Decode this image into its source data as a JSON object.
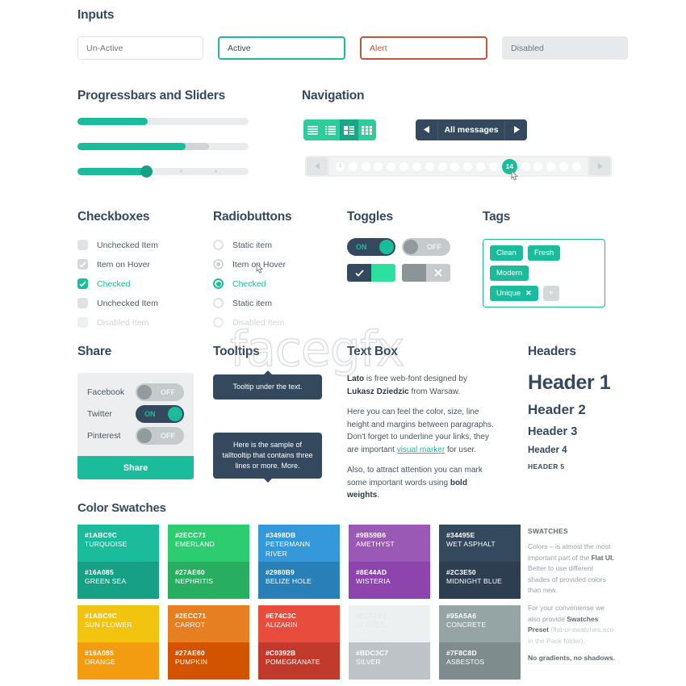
{
  "watermark": "facegfx",
  "sections": {
    "inputs": "Inputs",
    "progress": "Progressbars and Sliders",
    "navigation": "Navigation",
    "checkboxes": "Checkboxes",
    "radiobuttons": "Radiobuttons",
    "toggles": "Toggles",
    "tags": "Tags",
    "share": "Share",
    "tooltips": "Tooltips",
    "textbox": "Text Box",
    "headers": "Headers",
    "swatches": "Color Swatches"
  },
  "inputs": [
    {
      "name": "un-active",
      "value": "",
      "placeholder": "Un-Active",
      "state": "default"
    },
    {
      "name": "active",
      "value": "Active",
      "placeholder": "Active",
      "state": "active"
    },
    {
      "name": "alert",
      "value": "Alert",
      "placeholder": "Alert",
      "state": "alert"
    },
    {
      "name": "disabled",
      "value": "",
      "placeholder": "Disabled",
      "state": "disabled"
    }
  ],
  "progress": {
    "bars": [
      {
        "percent": 41,
        "secondary": 0
      },
      {
        "percent": 63,
        "secondary": 77
      }
    ],
    "slider": {
      "percent": 40,
      "ticks_percent": [
        60,
        80
      ]
    }
  },
  "navigation": {
    "view_modes": [
      {
        "icon": "list-lines-icon",
        "active": false
      },
      {
        "icon": "list-bullets-icon",
        "active": false
      },
      {
        "icon": "list-detail-icon",
        "active": true
      },
      {
        "icon": "grid-icon",
        "active": false
      }
    ],
    "messages": {
      "prev_icon": "triangle-left-icon",
      "label": "All messages",
      "next_icon": "triangle-right-icon"
    },
    "pager": {
      "prev_icon": "triangle-left-icon",
      "next_icon": "triangle-right-icon",
      "first_label": "1",
      "current_label": "14",
      "dots_before_current": 12,
      "dots_after_current": 5
    }
  },
  "checkboxes": [
    {
      "label": "Unchecked Item",
      "state": "unchecked"
    },
    {
      "label": "Item on Hover",
      "state": "hover"
    },
    {
      "label": "Checked",
      "state": "checked"
    },
    {
      "label": "Unchecked Item",
      "state": "unchecked"
    },
    {
      "label": "Disabled Item",
      "state": "disabled"
    }
  ],
  "radiobuttons": [
    {
      "label": "Static item",
      "state": "unchecked"
    },
    {
      "label": "Item on Hover",
      "state": "hover"
    },
    {
      "label": "Checked",
      "state": "checked"
    },
    {
      "label": "Static item",
      "state": "unchecked"
    },
    {
      "label": "Disabled Item",
      "state": "disabled"
    }
  ],
  "toggles": {
    "pill_on": "ON",
    "pill_off": "OFF",
    "square_on_icon": "check-icon",
    "square_off_icon": "cross-icon"
  },
  "tags": {
    "items": [
      "Clean",
      "Fresh",
      "Modern"
    ],
    "removable": {
      "label": "Unique",
      "remove_icon": "cross-icon"
    },
    "add_label": "+"
  },
  "share": {
    "rows": [
      {
        "label": "Facebook",
        "state": "OFF"
      },
      {
        "label": "Twitter",
        "state": "ON"
      },
      {
        "label": "Pinterest",
        "state": "OFF"
      }
    ],
    "button": "Share"
  },
  "tooltips": [
    "Tooltip under the text.",
    "Here is the sample of talltooltip that contains three lines or more. More."
  ],
  "textbox": {
    "p1_bold1": "Lato",
    "p1_mid": " is free web-font designed by ",
    "p1_bold2": "Lukasz Dziedzic",
    "p1_end": " from Warsaw.",
    "p2_start": "Here you can feel the color, size, line height and margins between paragraphs. Don't forget to underline your links, they are important ",
    "p2_link": "visual marker",
    "p2_end": " for user.",
    "p3_start": "Also, to attract attention you can mark some important words using ",
    "p3_bold": "bold weights",
    "p3_end": "."
  },
  "headers": {
    "h1": "Header 1",
    "h2": "Header 2",
    "h3": "Header 3",
    "h4": "Header 4",
    "h5": "HEADER 5"
  },
  "swatches": {
    "columns": [
      {
        "top": {
          "hex": "#1ABC9C",
          "name": "TURQUOISE",
          "color": "#1abc9c"
        },
        "bottom": {
          "hex": "#16A085",
          "name": "GREEN SEA",
          "color": "#16a085"
        }
      },
      {
        "top": {
          "hex": "#2ECC71",
          "name": "EMERLAND",
          "color": "#2ecc71"
        },
        "bottom": {
          "hex": "#27AE60",
          "name": "NEPHRITIS",
          "color": "#27ae60"
        }
      },
      {
        "top": {
          "hex": "#3498DB",
          "name": "PETERMANN RIVER",
          "color": "#3498db"
        },
        "bottom": {
          "hex": "#2980B9",
          "name": "BELIZE HOLE",
          "color": "#2980b9"
        }
      },
      {
        "top": {
          "hex": "#9B59B6",
          "name": "AMETHYST",
          "color": "#9b59b6"
        },
        "bottom": {
          "hex": "#8E44AD",
          "name": "WISTERIA",
          "color": "#8e44ad"
        }
      },
      {
        "top": {
          "hex": "#34495E",
          "name": "WET ASPHALT",
          "color": "#34495e"
        },
        "bottom": {
          "hex": "#2C3E50",
          "name": "MIDNIGHT BLUE",
          "color": "#2c3e50"
        }
      }
    ],
    "columns2": [
      {
        "top": {
          "hex": "#1ABC9C",
          "name": "SUN FLOWER",
          "color": "#f1c40f"
        },
        "bottom": {
          "hex": "#16A085",
          "name": "ORANGE",
          "color": "#f39c12"
        }
      },
      {
        "top": {
          "hex": "#2ECC71",
          "name": "CARROT",
          "color": "#e67e22"
        },
        "bottom": {
          "hex": "#27AE60",
          "name": "PUMPKIN",
          "color": "#d35400"
        }
      },
      {
        "top": {
          "hex": "#E74C3C",
          "name": "ALIZARIN",
          "color": "#e74c3c"
        },
        "bottom": {
          "hex": "#C0392B",
          "name": "POMEGRANATE",
          "color": "#c0392b"
        }
      },
      {
        "top": {
          "hex": "#ECF0F1",
          "name": "CLOUDS",
          "color": "#ecf0f1",
          "light": true
        },
        "bottom": {
          "hex": "#BDC3C7",
          "name": "SILVER",
          "color": "#bdc3c7"
        }
      },
      {
        "top": {
          "hex": "#95A5A6",
          "name": "CONCRETE",
          "color": "#95a5a6"
        },
        "bottom": {
          "hex": "#7F8C8D",
          "name": "ASBESTOS",
          "color": "#7f8c8d"
        }
      }
    ],
    "note": {
      "heading": "SWATCHES",
      "p1": "Colors – is almost the most important part of the ",
      "p1_bold": "Flat UI.",
      "p1_end": " Better to use different shades of provided colors than new.",
      "p2_start": "For your conveniense we also provide ",
      "p2_bold": "Swatches Preset",
      "p2_muted": " (flat-ui-swatches.aco in the Pack folder).",
      "p3": "No gradients, no shadows."
    }
  }
}
